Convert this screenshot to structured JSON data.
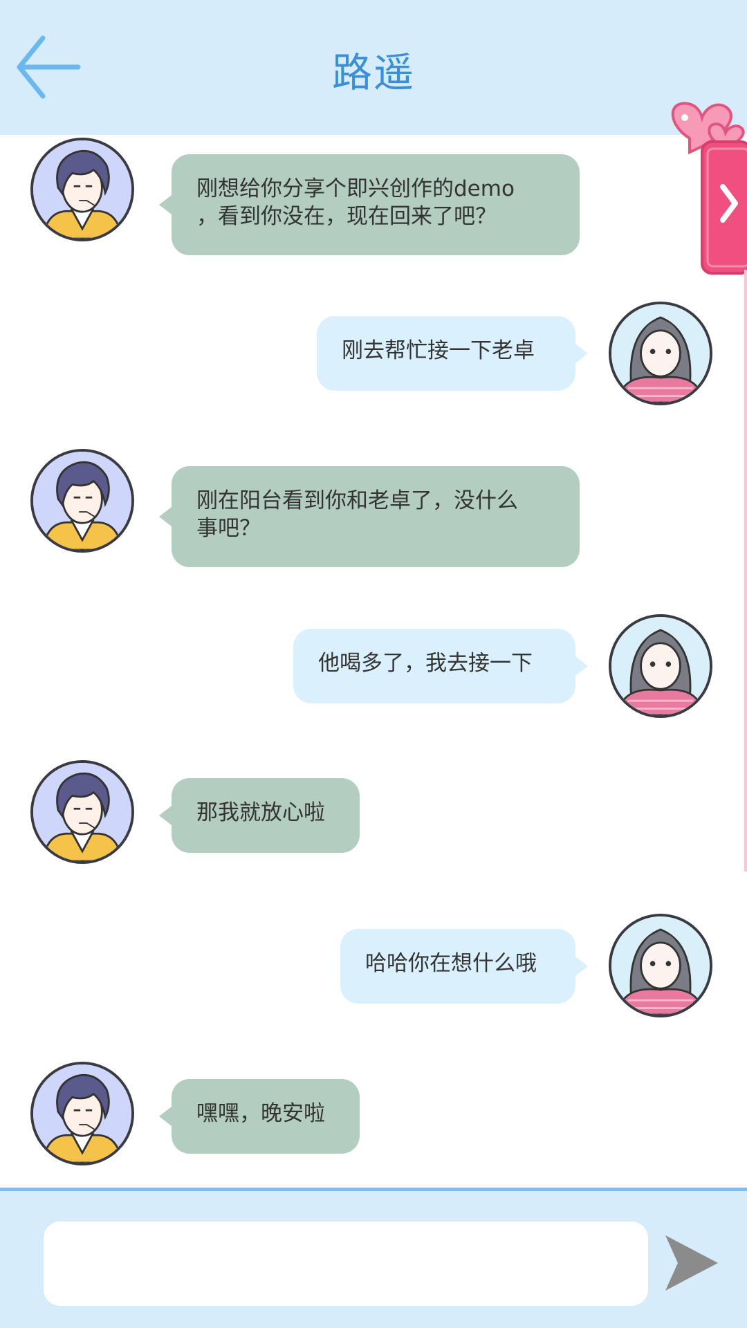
{
  "header": {
    "title": "路遥",
    "back_icon": "arrow-left-icon"
  },
  "side_tab": {
    "icon": "hearts-icon",
    "arrow_icon": "chevron-right-icon"
  },
  "colors": {
    "header_bg": "#d6ecfb",
    "title": "#3a8fd6",
    "incoming_bubble": "#b3cec0",
    "outgoing_bubble": "#daf1fd",
    "footer_border": "#7bbff0"
  },
  "messages": [
    {
      "from": "contact",
      "line1": "刚想给你分享个即兴创作的demo",
      "line2": "，看到你没在，现在回来了吧？"
    },
    {
      "from": "me",
      "line1": "刚去帮忙接一下老卓"
    },
    {
      "from": "contact",
      "line1": "刚在阳台看到你和老卓了，没什么",
      "line2": "事吧？"
    },
    {
      "from": "me",
      "line1": "他喝多了，我去接一下"
    },
    {
      "from": "contact",
      "line1": "那我就放心啦"
    },
    {
      "from": "me",
      "line1": "哈哈你在想什么哦"
    },
    {
      "from": "contact",
      "line1": "嘿嘿，晚安啦"
    }
  ],
  "composer": {
    "value": "",
    "placeholder": "",
    "send_icon": "send-icon"
  }
}
